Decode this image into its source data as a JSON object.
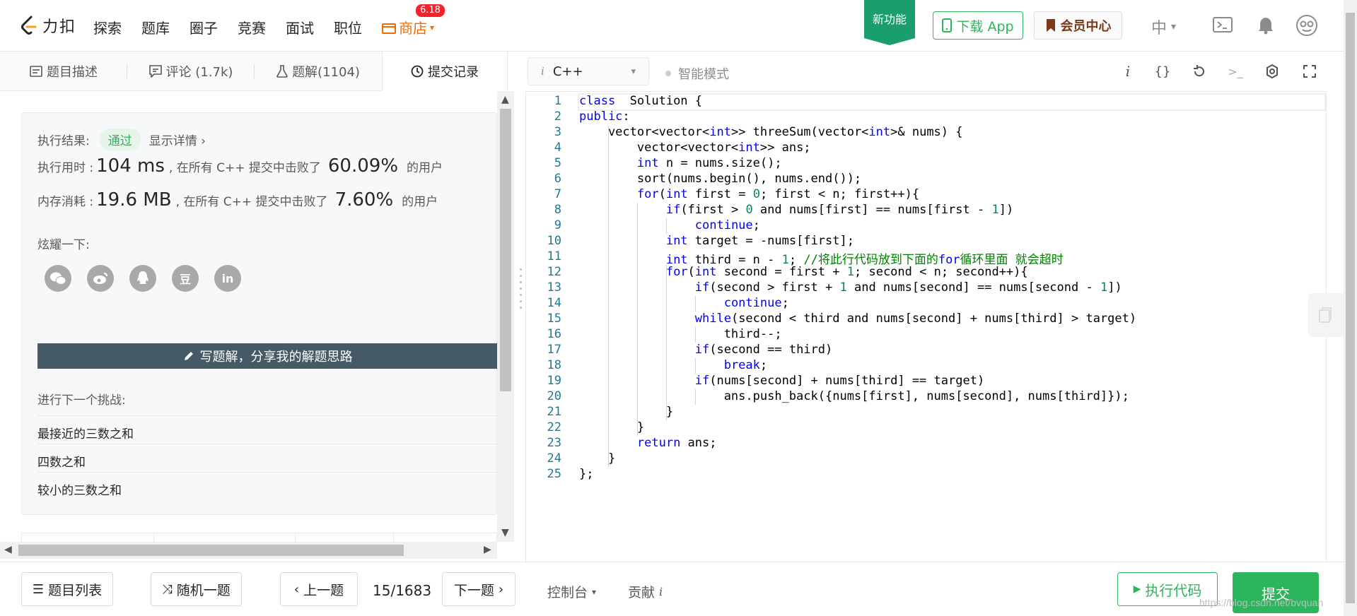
{
  "nav": {
    "logo_text": "力扣",
    "items": [
      "探索",
      "题库",
      "圈子",
      "竞赛",
      "面试",
      "职位"
    ],
    "store_label": "商店",
    "store_badge": "6.18",
    "new_feature": "新功能",
    "download_label": "下载 App",
    "member_label": "会员中心",
    "lang_label": "中"
  },
  "left_tabs": [
    {
      "label": "题目描述",
      "icon": "document-icon"
    },
    {
      "label": "评论 (1.7k)",
      "icon": "comment-icon"
    },
    {
      "label": "题解(1104)",
      "icon": "flask-icon"
    },
    {
      "label": "提交记录",
      "icon": "clock-icon"
    }
  ],
  "result": {
    "result_label": "执行结果:",
    "result_value": "通过",
    "detail_link": "显示详情 ›",
    "time_label": "执行用时 :",
    "time_value": "104 ms",
    "time_mid": ", 在所有 C++ 提交中击败了",
    "time_percent": "60.09%",
    "time_suffix": "的用户",
    "mem_label": "内存消耗 :",
    "mem_value": "19.6 MB",
    "mem_mid": ", 在所有 C++ 提交中击败了",
    "mem_percent": "7.60%",
    "mem_suffix": "的用户",
    "share_label": "炫耀一下:",
    "share_icons": [
      "wechat-icon",
      "weibo-icon",
      "qq-icon",
      "douban-icon",
      "linkedin-icon"
    ],
    "douban_glyph": "豆",
    "linkedin_glyph": "in",
    "write_button": "写题解，分享我的解题思路",
    "next_title": "进行下一个挑战:",
    "next_items": [
      "最接近的三数之和",
      "四数之和",
      "较小的三数之和"
    ]
  },
  "editor_toolbar": {
    "language": "C++",
    "smart_mode": "智能模式",
    "icons": [
      "info-icon",
      "braces-icon",
      "reset-icon",
      "terminal-icon",
      "settings-icon",
      "fullscreen-icon"
    ]
  },
  "code": {
    "line_numbers": [
      "1",
      "2",
      "3",
      "4",
      "5",
      "6",
      "7",
      "8",
      "9",
      "10",
      "11",
      "12",
      "13",
      "14",
      "15",
      "16",
      "17",
      "18",
      "19",
      "20",
      "21",
      "22",
      "23",
      "24",
      "25"
    ],
    "lines": [
      [
        [
          "kw",
          "class"
        ],
        [
          "",
          "  Solution {"
        ]
      ],
      [
        [
          "kw",
          "public"
        ],
        [
          "",
          ":"
        ]
      ],
      [
        [
          "",
          "    vector<vector<"
        ],
        [
          "kw",
          "int"
        ],
        [
          "",
          ">> threeSum(vector<"
        ],
        [
          "kw",
          "int"
        ],
        [
          "",
          ">& nums) {"
        ]
      ],
      [
        [
          "",
          "        vector<vector<"
        ],
        [
          "kw",
          "int"
        ],
        [
          "",
          ">> ans;"
        ]
      ],
      [
        [
          "",
          "        "
        ],
        [
          "kw",
          "int"
        ],
        [
          "",
          "",
          " n = nums.size();"
        ]
      ],
      [
        [
          "",
          "        sort(nums.begin(), nums.end());"
        ]
      ],
      [
        [
          "",
          "        "
        ],
        [
          "kw",
          "for"
        ],
        [
          "",
          "("
        ],
        [
          "kw",
          "int"
        ],
        [
          "",
          " first = "
        ],
        [
          "num",
          "0"
        ],
        [
          "",
          "; first < n; first++){"
        ]
      ],
      [
        [
          "",
          "            "
        ],
        [
          "kw",
          "if"
        ],
        [
          "",
          "(first > "
        ],
        [
          "num",
          "0"
        ],
        [
          "",
          " and nums[first] == nums[first - "
        ],
        [
          "num",
          "1"
        ],
        [
          "",
          "])"
        ]
      ],
      [
        [
          "",
          "                "
        ],
        [
          "kw",
          "continue"
        ],
        [
          "",
          ";"
        ]
      ],
      [
        [
          "",
          "            "
        ],
        [
          "kw",
          "int"
        ],
        [
          "",
          " target = -nums[first];"
        ]
      ],
      [
        [
          "",
          "            "
        ],
        [
          "kw",
          "int"
        ],
        [
          "",
          " third = n - "
        ],
        [
          "num",
          "1"
        ],
        [
          "",
          "; "
        ],
        [
          "cm",
          "//将此行代码放到下面的"
        ],
        [
          "kw",
          "for"
        ],
        [
          "cm",
          "循环里面 就会超时"
        ]
      ],
      [
        [
          "",
          "            "
        ],
        [
          "kw",
          "for"
        ],
        [
          "",
          "("
        ],
        [
          "kw",
          "int"
        ],
        [
          "",
          " second = first + "
        ],
        [
          "num",
          "1"
        ],
        [
          "",
          "; second < n; second++){"
        ]
      ],
      [
        [
          "",
          "                "
        ],
        [
          "kw",
          "if"
        ],
        [
          "",
          "(second > first + "
        ],
        [
          "num",
          "1"
        ],
        [
          "",
          " and nums[second] == nums[second - "
        ],
        [
          "num",
          "1"
        ],
        [
          "",
          "])"
        ]
      ],
      [
        [
          "",
          "                    "
        ],
        [
          "kw",
          "continue"
        ],
        [
          "",
          ";"
        ]
      ],
      [
        [
          "",
          "                "
        ],
        [
          "kw",
          "while"
        ],
        [
          "",
          "(second < third and nums[second] + nums[third] > target)"
        ]
      ],
      [
        [
          "",
          "                    third--;"
        ]
      ],
      [
        [
          "",
          "                "
        ],
        [
          "kw",
          "if"
        ],
        [
          "",
          "(second == third)"
        ]
      ],
      [
        [
          "",
          "                    "
        ],
        [
          "kw",
          "break"
        ],
        [
          "",
          ";"
        ]
      ],
      [
        [
          "",
          "                "
        ],
        [
          "kw",
          "if"
        ],
        [
          "",
          "(nums[second] + nums[third] == target)"
        ]
      ],
      [
        [
          "",
          "                    ans.push_back({nums[first], nums[second], nums[third]});"
        ]
      ],
      [
        [
          "",
          "            }"
        ]
      ],
      [
        [
          "",
          "        }"
        ]
      ],
      [
        [
          "",
          "        "
        ],
        [
          "kw",
          "return"
        ],
        [
          "",
          " ans;"
        ]
      ],
      [
        [
          "",
          "    }"
        ]
      ],
      [
        [
          "",
          "};"
        ]
      ]
    ]
  },
  "bottom": {
    "problem_list": "题目列表",
    "random": "随机一题",
    "prev": "上一题",
    "page": "15/1683",
    "next": "下一题",
    "console": "控制台",
    "contribute": "贡献",
    "run": "执行代码",
    "submit": "提交",
    "watermark": "https://blog.csdn.net/bvquan"
  },
  "colors": {
    "accent_green": "#2db55d",
    "store_orange": "#f56a00",
    "badge_red": "#f5222d",
    "keyword_blue": "#0000ff",
    "number_green": "#098658",
    "comment_green": "#008000"
  }
}
